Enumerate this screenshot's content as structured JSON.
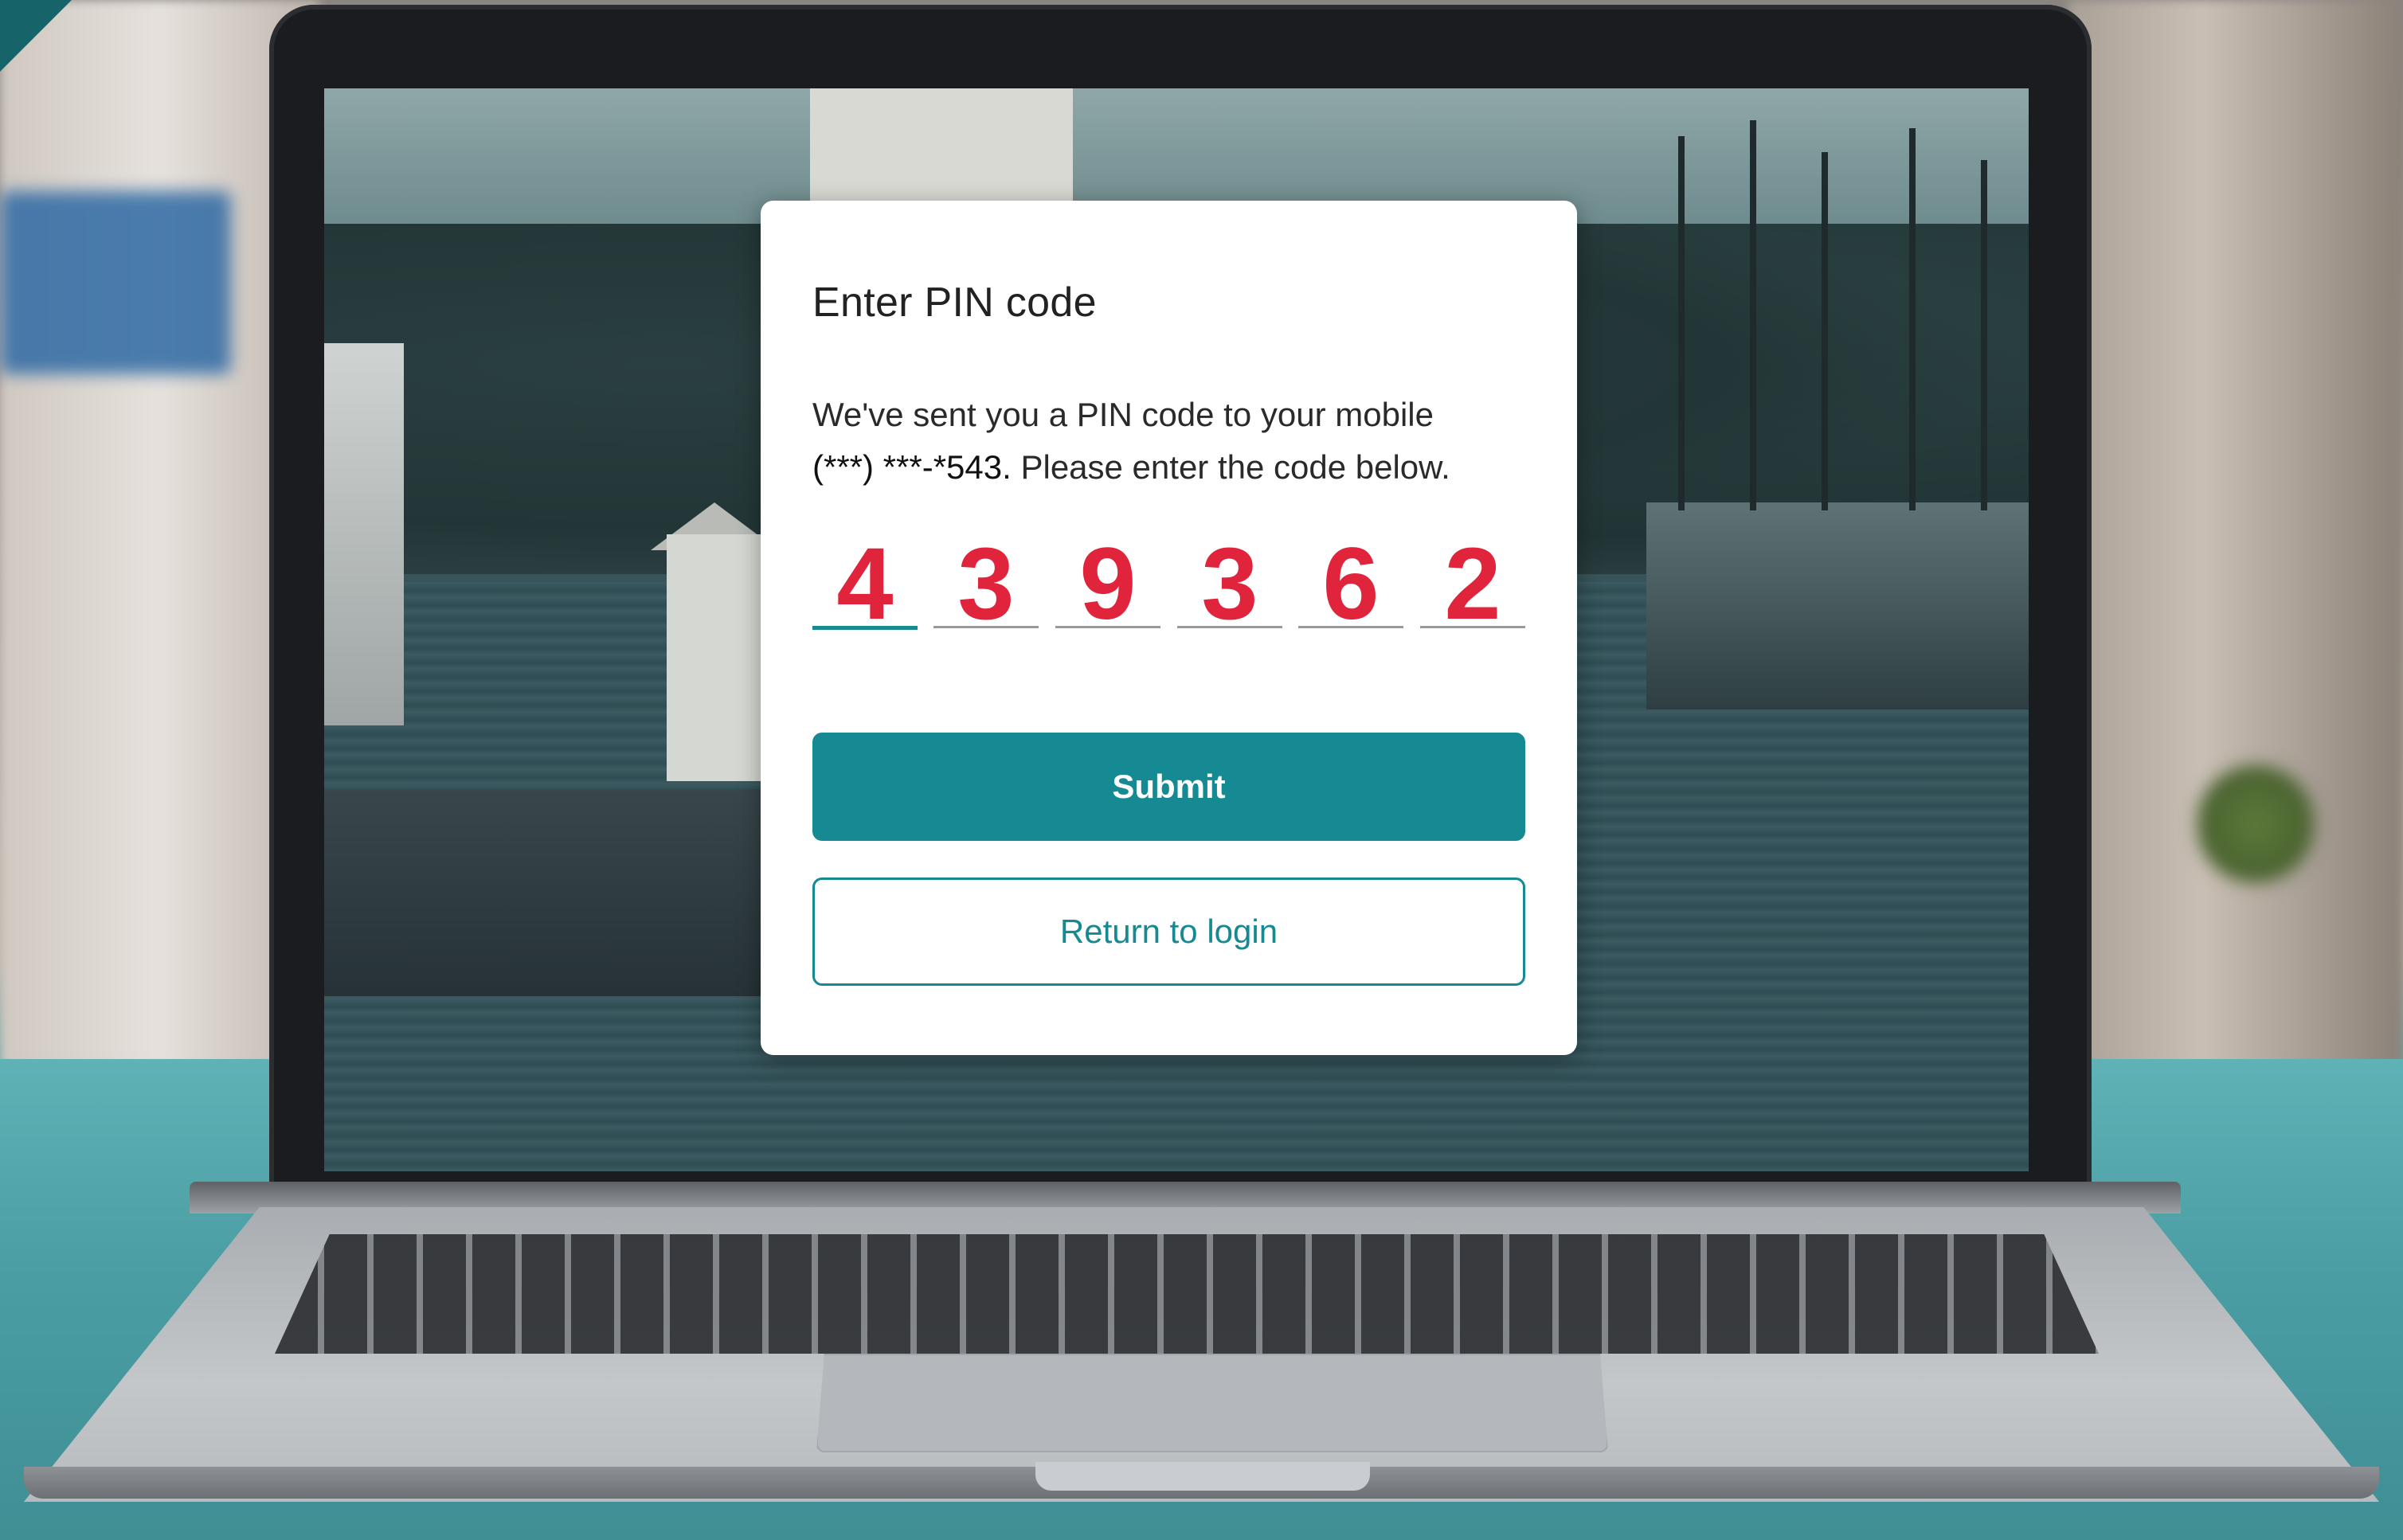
{
  "pin_dialog": {
    "title": "Enter PIN code",
    "message_prefix": "We've sent you a PIN code to your mobile",
    "masked_phone": "(***) ***-*543.",
    "message_suffix": "Please enter the code below.",
    "digits": [
      "4",
      "3",
      "9",
      "3",
      "6",
      "2"
    ],
    "submit_label": "Submit",
    "return_label": "Return to login"
  },
  "colors": {
    "accent": "#158a92",
    "pin_digit": "#e0243b"
  }
}
